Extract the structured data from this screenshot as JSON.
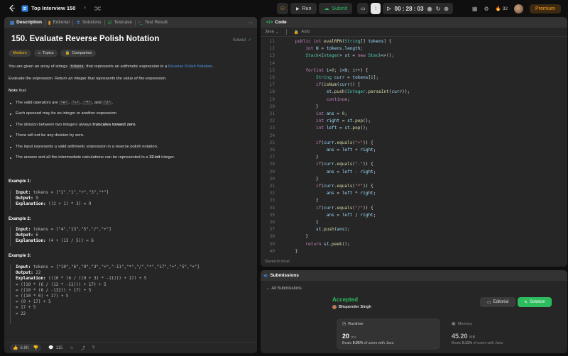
{
  "topbar": {
    "title": "Top Interview 150",
    "run_label": "Run",
    "submit_label": "Submit",
    "timer": "00 : 28 : 03",
    "streak": "32",
    "premium_label": "Premium"
  },
  "description_panel": {
    "tabs": [
      "Description",
      "Editorial",
      "Solutions",
      "Testcase",
      "Test Result"
    ],
    "title": "150. Evaluate Reverse Polish Notation",
    "status": "Solved",
    "difficulty": "Medium",
    "chips": [
      "Topics",
      "Companies"
    ],
    "intro_pre": "You are given an array of strings ",
    "intro_code": "tokens",
    "intro_mid": " that represents an arithmetic expression in a ",
    "intro_link": "Reverse Polish Notation",
    "intro_post": ".",
    "evaluate_pre": "Evaluate the expression. Return ",
    "evaluate_em": "an integer that represents the value of the expression",
    "evaluate_post": ".",
    "note_label": "Note",
    "note_post": " that:",
    "notes": {
      "n1_pre": "The valid operators are ",
      "op1": "'+'",
      "op2": "'-'",
      "op3": "'*'",
      "n1_and": ", and ",
      "op4": "'/'",
      "n1_post": ".",
      "n2": "Each operand may be an integer or another expression.",
      "n3_pre": "The division between two integers always ",
      "n3_bold": "truncates toward zero",
      "n3_post": ".",
      "n4": "There will not be any division by zero.",
      "n5": "The input represents a valid arithmetic expression in a reverse polish notation.",
      "n6_pre": "The answer and all the intermediate calculations can be represented in a ",
      "n6_bold": "32-bit",
      "n6_post": " integer."
    },
    "examples": [
      {
        "title": "Example 1:",
        "input": "tokens = [\"2\",\"1\",\"+\",\"3\",\"*\"]",
        "output": "9",
        "explanation": "((2 + 1) * 3) = 9"
      },
      {
        "title": "Example 2:",
        "input": "tokens = [\"4\",\"13\",\"5\",\"/\",\"+\"]",
        "output": "6",
        "explanation": "(4 + (13 / 5)) = 6"
      },
      {
        "title": "Example 3:",
        "input": "tokens = [\"10\",\"6\",\"9\",\"3\",\"+\",\"-11\",\"*\",\"/\",\"*\",\"17\",\"+\",\"5\",\"+\"]",
        "output": "22",
        "explanation": "((10 * (6 / ((9 + 3) * -11))) + 17) + 5",
        "steps": [
          "= ((10 * (6 / (12 * -11))) + 17) + 5",
          "= ((10 * (6 / -132)) + 17) + 5",
          "= ((10 * 0) + 17) + 5",
          "= (0 + 17) + 5",
          "= 17 + 5",
          "= 22"
        ]
      }
    ],
    "labels": {
      "input": "Input:",
      "output": "Output:",
      "explanation": "Explanation:"
    },
    "footer": {
      "likes": "6.8K",
      "comments": "115"
    }
  },
  "code_panel": {
    "tab": "Code",
    "language": "Java",
    "autosave": "Auto",
    "saved_status": "Saved to local",
    "line_numbers": [
      "11",
      "12",
      "13",
      "14",
      "15",
      "16",
      "17",
      "18",
      "19",
      "20",
      "21",
      "22",
      "23",
      "24",
      "25",
      "26",
      "27",
      "28",
      "29",
      "30",
      "31",
      "32",
      "33",
      "34",
      "35",
      "36",
      "37",
      "38",
      "39",
      "40"
    ]
  },
  "submissions_panel": {
    "tab": "Submissions",
    "all_submissions": "All Submissions",
    "result": "Accepted",
    "author": "Bhupender Singh",
    "editorial_btn": "Editorial",
    "solution_btn": "Solution",
    "runtime": {
      "label": "Runtime",
      "value": "20",
      "unit": "ms",
      "beats_pre": "Beats ",
      "beats_val": "8.95%",
      "beats_post": " of users with Java"
    },
    "memory": {
      "label": "Memory",
      "value": "45.20",
      "unit": "MB",
      "beats_pre": "Beats ",
      "beats_val": "5.11%",
      "beats_post": " of users with Java"
    }
  },
  "colors": {
    "accent": "#ffa116",
    "accepted": "#2cbb5d",
    "link": "#4a90e2",
    "medium": "#ffb800"
  }
}
